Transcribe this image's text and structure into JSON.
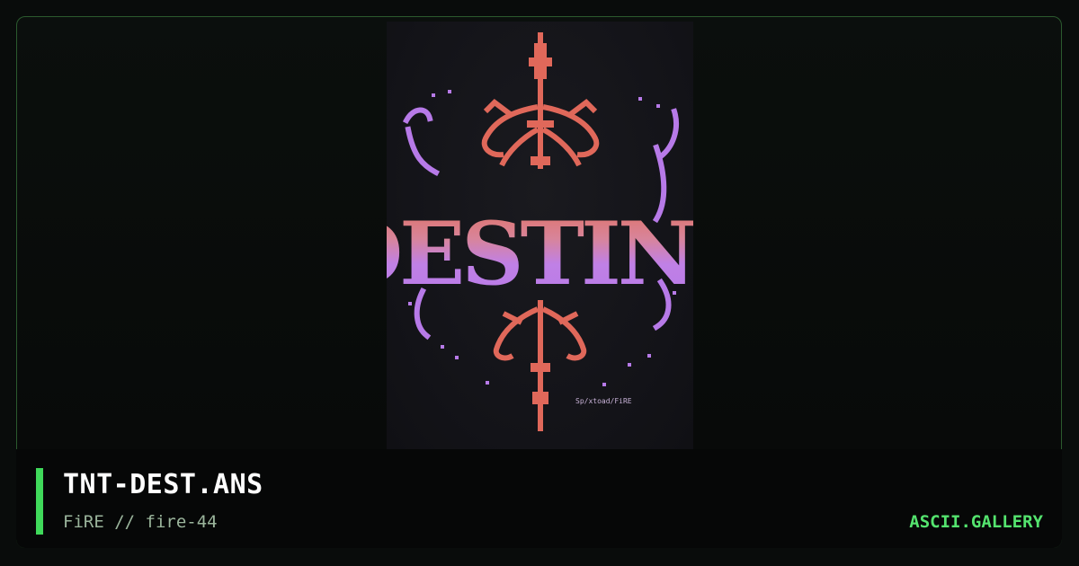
{
  "artwork": {
    "filename": "TNT-DEST.ANS",
    "credits": "FiRE // fire-44",
    "logo_text": "DESTINY",
    "signature": "Sp/xtoad/FiRE"
  },
  "site": {
    "name": "ASCII.GALLERY"
  },
  "colors": {
    "accent": "#3fd95a",
    "frame_border": "#2b5a2e",
    "ornament": "#e0685a",
    "logo_violet": "#b77ae8"
  }
}
